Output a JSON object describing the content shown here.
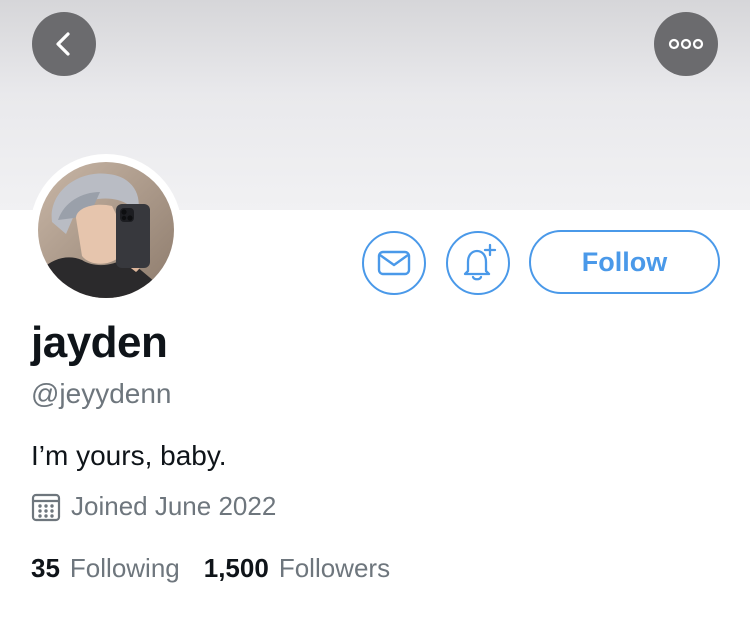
{
  "colors": {
    "accent": "#4a99e9",
    "text_primary": "#0f1419",
    "text_secondary": "#6e767d",
    "overlay_button": "#6b6b6e"
  },
  "header": {
    "back_icon": "chevron-left-icon",
    "more_icon": "ellipsis-icon"
  },
  "profile": {
    "display_name": "jayden",
    "handle": "@jeyydenn",
    "bio": "I’m yours, baby.",
    "joined": "Joined June 2022",
    "avatar_icon": "avatar-photo"
  },
  "actions": {
    "message_icon": "envelope-icon",
    "notify_icon": "bell-plus-icon",
    "follow_label": "Follow"
  },
  "stats": {
    "following_count": "35",
    "following_label": "Following",
    "followers_count": "1,500",
    "followers_label": "Followers"
  }
}
